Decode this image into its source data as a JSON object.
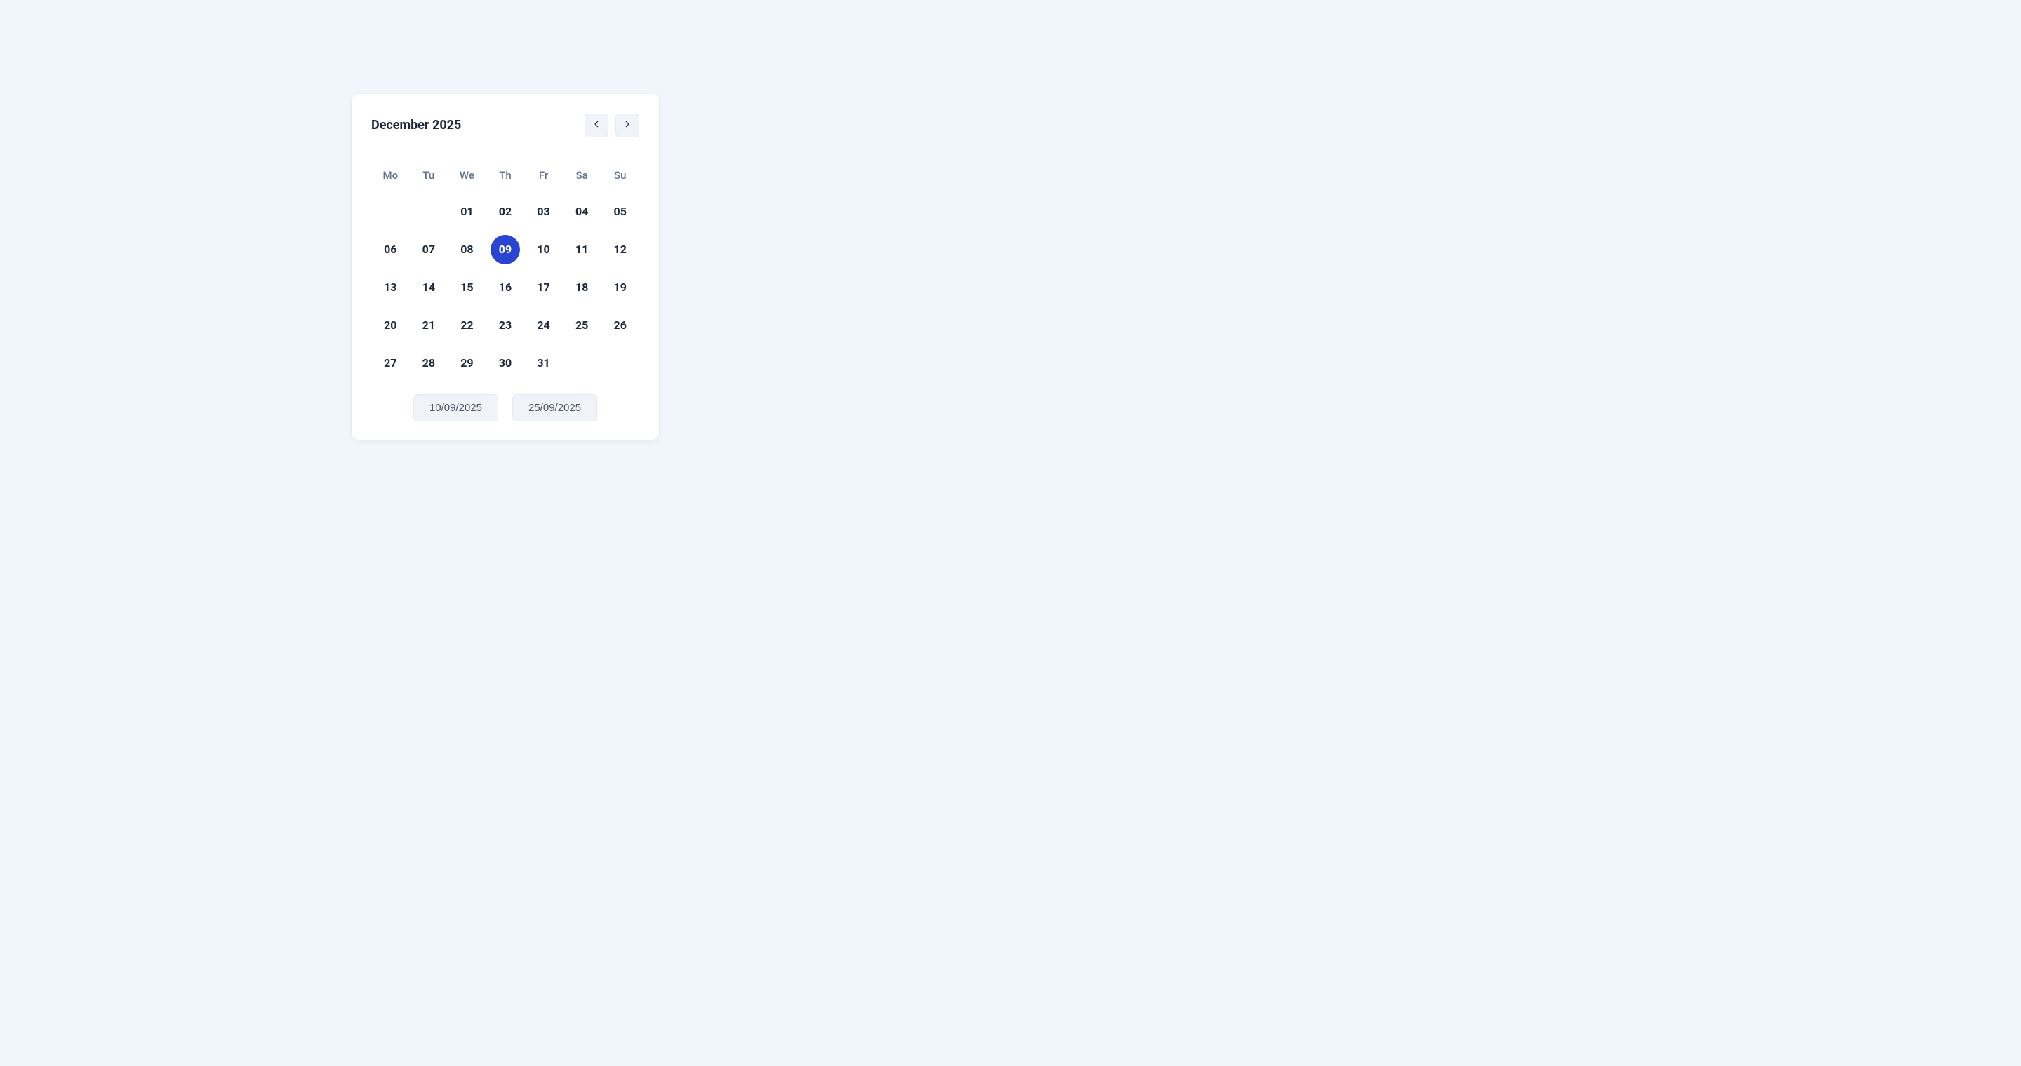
{
  "calendar": {
    "title": "December 2025",
    "weekdays": [
      "Mo",
      "Tu",
      "We",
      "Th",
      "Fr",
      "Sa",
      "Su"
    ],
    "leading_blank": 2,
    "days": [
      "01",
      "02",
      "03",
      "04",
      "05",
      "06",
      "07",
      "08",
      "09",
      "10",
      "11",
      "12",
      "13",
      "14",
      "15",
      "16",
      "17",
      "18",
      "19",
      "20",
      "21",
      "22",
      "23",
      "24",
      "25",
      "26",
      "27",
      "28",
      "29",
      "30",
      "31"
    ],
    "selected_day": "09"
  },
  "quick_dates": [
    "10/09/2025",
    "25/09/2025"
  ]
}
